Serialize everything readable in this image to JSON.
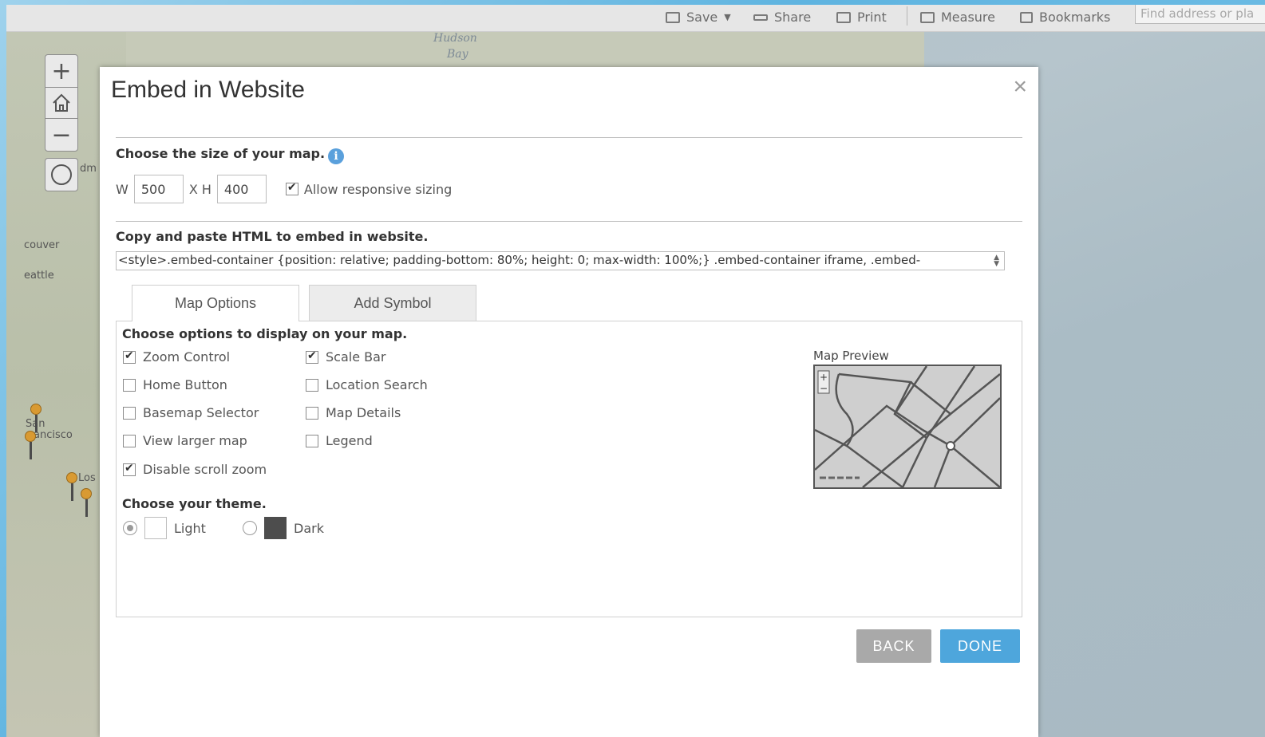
{
  "toolbar": {
    "save": "Save",
    "share": "Share",
    "print": "Print",
    "measure": "Measure",
    "bookmarks": "Bookmarks",
    "search_placeholder": "Find address or pla"
  },
  "map": {
    "water_label_1": "Hudson",
    "water_label_2": "Bay",
    "cities": {
      "vancouver": "couver",
      "seattle": "eattle",
      "san": "San",
      "francisco": "ancisco",
      "los": "Los",
      "edm": "dm"
    },
    "controls": {
      "zoom_in": "+",
      "zoom_out": "−"
    }
  },
  "modal": {
    "title": "Embed in Website",
    "close": "×",
    "size_section": {
      "label": "Choose the size of your map.",
      "info": "i",
      "width_label": "W",
      "width_value": "500",
      "times_label": "X H",
      "height_value": "400",
      "responsive_label": "Allow responsive sizing",
      "responsive_checked": true
    },
    "embed_section": {
      "label": "Copy and paste HTML to embed in website.",
      "code": "<style>.embed-container {position: relative; padding-bottom: 80%; height: 0; max-width: 100%;} .embed-container iframe, .embed-"
    },
    "tabs": [
      {
        "label": "Map Options",
        "active": true
      },
      {
        "label": "Add Symbol",
        "active": false
      }
    ],
    "options_section": {
      "label": "Choose options to display on your map.",
      "left_column": [
        {
          "label": "Zoom Control",
          "checked": true
        },
        {
          "label": "Home Button",
          "checked": false
        },
        {
          "label": "Basemap Selector",
          "checked": false
        },
        {
          "label": "View larger map",
          "checked": false
        },
        {
          "label": "Disable scroll zoom",
          "checked": true
        }
      ],
      "right_column": [
        {
          "label": "Scale Bar",
          "checked": true
        },
        {
          "label": "Location Search",
          "checked": false
        },
        {
          "label": "Map Details",
          "checked": false
        },
        {
          "label": "Legend",
          "checked": false
        }
      ]
    },
    "theme_section": {
      "label": "Choose your theme.",
      "light_label": "Light",
      "dark_label": "Dark",
      "selected": "light",
      "light_color": "#ffffff",
      "dark_color": "#4d4d4d"
    },
    "preview": {
      "label": "Map Preview"
    },
    "buttons": {
      "back": "BACK",
      "done": "DONE"
    }
  },
  "colors": {
    "accent": "#4ea6dc",
    "back_button": "#a9a9a9",
    "info_icon": "#5aa0dc"
  }
}
